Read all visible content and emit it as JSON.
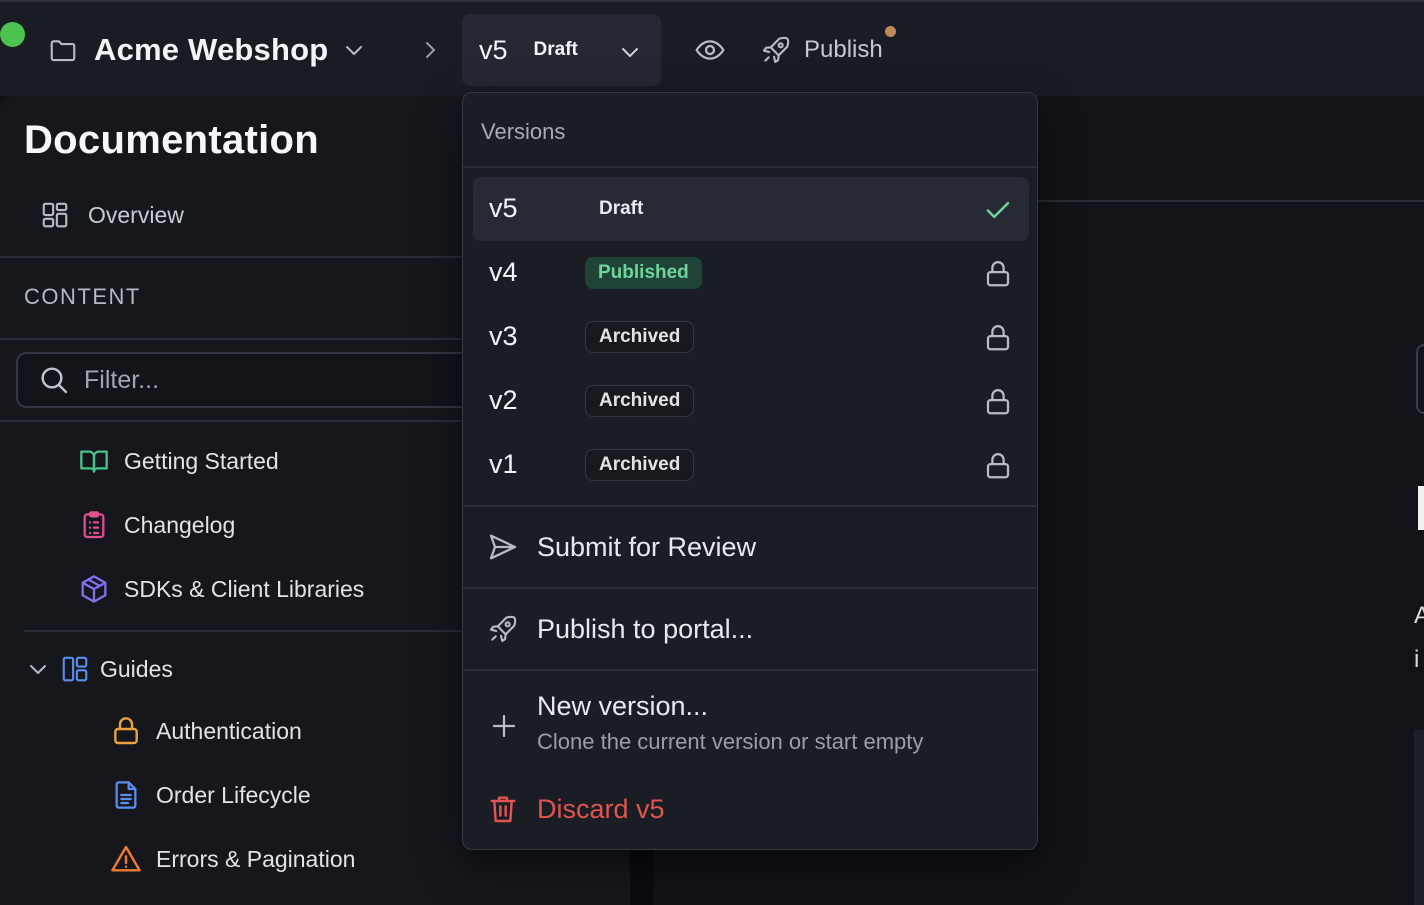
{
  "topbar": {
    "project_name": "Acme Webshop",
    "current_version": "v5",
    "current_state": "Draft",
    "publish_label": "Publish",
    "publish_indicator_color": "#c08a5a",
    "status_dot_color": "#4cc24f"
  },
  "sidebar": {
    "title": "Documentation",
    "overview_label": "Overview",
    "section_label": "CONTENT",
    "filter_placeholder": "Filter...",
    "items": [
      {
        "label": "Getting Started",
        "icon": "book-icon",
        "color": "#4cc38a"
      },
      {
        "label": "Changelog",
        "icon": "clipboard-list-icon",
        "color": "#e0508e"
      },
      {
        "label": "SDKs & Client Libraries",
        "icon": "package-icon",
        "color": "#7b74f0"
      }
    ],
    "group": {
      "label": "Guides",
      "icon": "layout-icon",
      "color": "#5b8def",
      "children": [
        {
          "label": "Authentication",
          "icon": "lock-icon",
          "color": "#e8a33a"
        },
        {
          "label": "Order Lifecycle",
          "icon": "file-text-icon",
          "color": "#5b8def"
        },
        {
          "label": "Errors & Pagination",
          "icon": "warning-icon",
          "color": "#f07a33"
        }
      ]
    }
  },
  "versions_menu": {
    "header": "Versions",
    "versions": [
      {
        "name": "v5",
        "state": "Draft",
        "selected": true,
        "state_icon": "check-icon"
      },
      {
        "name": "v4",
        "state": "Published",
        "selected": false,
        "state_icon": "lock-icon"
      },
      {
        "name": "v3",
        "state": "Archived",
        "selected": false,
        "state_icon": "lock-icon"
      },
      {
        "name": "v2",
        "state": "Archived",
        "selected": false,
        "state_icon": "lock-icon"
      },
      {
        "name": "v1",
        "state": "Archived",
        "selected": false,
        "state_icon": "lock-icon"
      }
    ],
    "submit_label": "Submit for Review",
    "publish_portal_label": "Publish to portal...",
    "new_version_label": "New version...",
    "new_version_sub": "Clone the current version or start empty",
    "discard_label": "Discard v5",
    "colors": {
      "check": "#6fd49c",
      "published_bg": "#1f4337",
      "published_fg": "#6fd49c",
      "danger": "#e0554f"
    }
  },
  "main_edge": {
    "char1": "A",
    "char2": "i"
  }
}
